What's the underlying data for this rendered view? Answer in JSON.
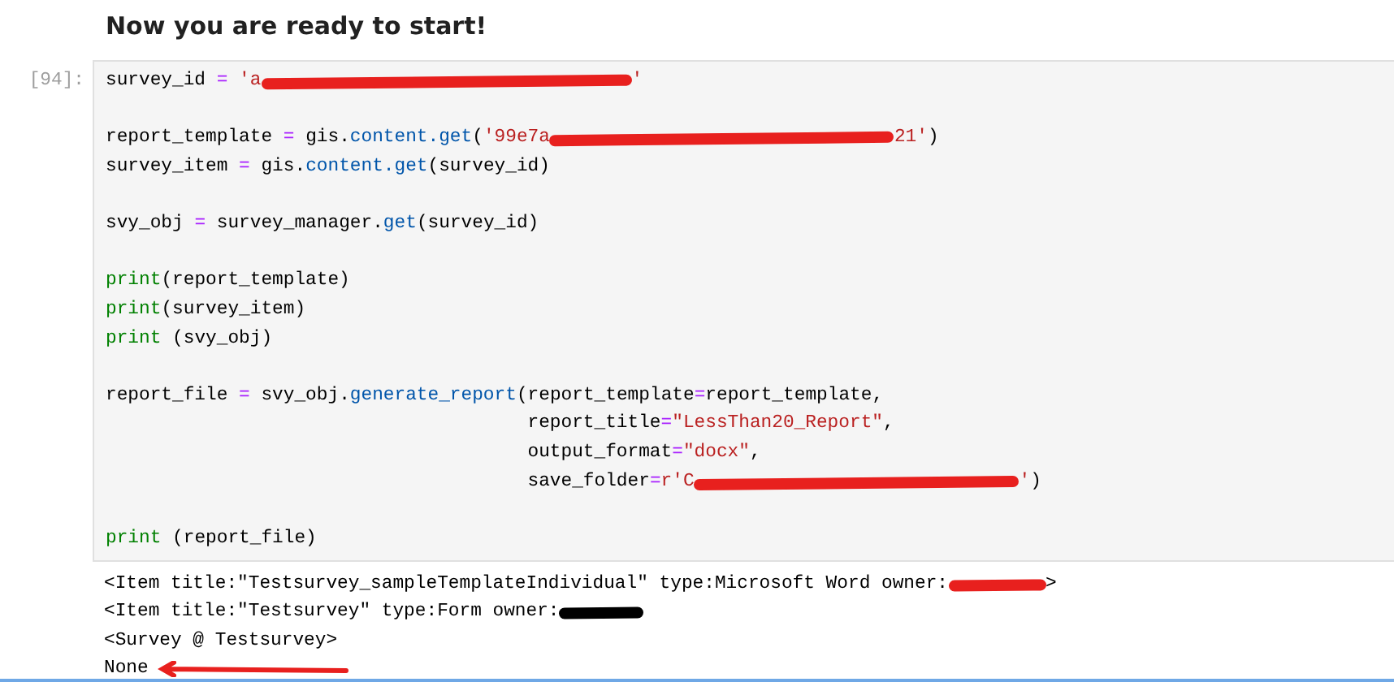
{
  "heading": "Now you are ready to start!",
  "cell": {
    "prompt": "[94]:",
    "lines": [
      {
        "kind": "code",
        "segments": [
          {
            "kind": "code",
            "tokens": [
              {
                "kind": "name",
                "text": "survey_id"
              },
              {
                "kind": "op",
                "text": " = "
              },
              {
                "kind": "str",
                "text": "'a"
              }
            ]
          },
          {
            "kind": "redaction",
            "color": "#e8201e"
          },
          {
            "kind": "code",
            "tokens": [
              {
                "kind": "str",
                "text": "'"
              }
            ]
          }
        ]
      },
      {
        "kind": "blank"
      },
      {
        "kind": "code",
        "segments": [
          {
            "kind": "code",
            "tokens": [
              {
                "kind": "name",
                "text": "report_template"
              },
              {
                "kind": "op",
                "text": " = "
              },
              {
                "kind": "name",
                "text": "gis."
              },
              {
                "kind": "prop",
                "text": "content.get"
              },
              {
                "kind": "name",
                "text": "("
              },
              {
                "kind": "str",
                "text": "'99e7a"
              }
            ]
          },
          {
            "kind": "redaction",
            "color": "#e8201e"
          },
          {
            "kind": "code",
            "tokens": [
              {
                "kind": "str",
                "text": "21'"
              },
              {
                "kind": "name",
                "text": ")"
              }
            ]
          }
        ]
      },
      {
        "kind": "code",
        "segments": [
          {
            "kind": "code",
            "tokens": [
              {
                "kind": "name",
                "text": "survey_item"
              },
              {
                "kind": "op",
                "text": " = "
              },
              {
                "kind": "name",
                "text": "gis."
              },
              {
                "kind": "prop",
                "text": "content.get"
              },
              {
                "kind": "name",
                "text": "(survey_id)"
              }
            ]
          }
        ]
      },
      {
        "kind": "blank"
      },
      {
        "kind": "code",
        "segments": [
          {
            "kind": "code",
            "tokens": [
              {
                "kind": "name",
                "text": "svy_obj"
              },
              {
                "kind": "op",
                "text": " = "
              },
              {
                "kind": "name",
                "text": "survey_manager."
              },
              {
                "kind": "prop",
                "text": "get"
              },
              {
                "kind": "name",
                "text": "(survey_id)"
              }
            ]
          }
        ]
      },
      {
        "kind": "blank"
      },
      {
        "kind": "code",
        "segments": [
          {
            "kind": "code",
            "tokens": [
              {
                "kind": "builtin",
                "text": "print"
              },
              {
                "kind": "name",
                "text": "(report_template)"
              }
            ]
          }
        ]
      },
      {
        "kind": "code",
        "segments": [
          {
            "kind": "code",
            "tokens": [
              {
                "kind": "builtin",
                "text": "print"
              },
              {
                "kind": "name",
                "text": "(survey_item)"
              }
            ]
          }
        ]
      },
      {
        "kind": "code",
        "segments": [
          {
            "kind": "code",
            "tokens": [
              {
                "kind": "builtin",
                "text": "print"
              },
              {
                "kind": "name",
                "text": " (svy_obj)"
              }
            ]
          }
        ]
      },
      {
        "kind": "blank"
      },
      {
        "kind": "code",
        "segments": [
          {
            "kind": "code",
            "tokens": [
              {
                "kind": "name",
                "text": "report_file"
              },
              {
                "kind": "op",
                "text": " = "
              },
              {
                "kind": "name",
                "text": "svy_obj."
              },
              {
                "kind": "prop",
                "text": "generate_report"
              },
              {
                "kind": "name",
                "text": "(report_template"
              },
              {
                "kind": "op",
                "text": "="
              },
              {
                "kind": "name",
                "text": "report_template,"
              }
            ]
          }
        ]
      },
      {
        "kind": "continuation",
        "segments": [
          {
            "kind": "code",
            "tokens": [
              {
                "kind": "name",
                "text": "report_title"
              },
              {
                "kind": "op",
                "text": "="
              },
              {
                "kind": "str",
                "text": "\"LessThan20_Report\""
              },
              {
                "kind": "name",
                "text": ","
              }
            ]
          }
        ]
      },
      {
        "kind": "continuation",
        "segments": [
          {
            "kind": "code",
            "tokens": [
              {
                "kind": "name",
                "text": "output_format"
              },
              {
                "kind": "op",
                "text": "="
              },
              {
                "kind": "str",
                "text": "\"docx\""
              },
              {
                "kind": "name",
                "text": ","
              }
            ]
          }
        ]
      },
      {
        "kind": "continuation",
        "segments": [
          {
            "kind": "code",
            "tokens": [
              {
                "kind": "name",
                "text": "save_folder"
              },
              {
                "kind": "op",
                "text": "="
              },
              {
                "kind": "str",
                "text": "r'C"
              }
            ]
          },
          {
            "kind": "redaction",
            "color": "#e8201e"
          },
          {
            "kind": "code",
            "tokens": [
              {
                "kind": "str",
                "text": "'"
              },
              {
                "kind": "name",
                "text": ")"
              }
            ]
          }
        ]
      },
      {
        "kind": "blank"
      },
      {
        "kind": "code",
        "segments": [
          {
            "kind": "code",
            "tokens": [
              {
                "kind": "builtin",
                "text": "print"
              },
              {
                "kind": "name",
                "text": " (report_file)"
              }
            ]
          }
        ]
      }
    ],
    "output": [
      {
        "segments": [
          {
            "kind": "text",
            "text": "<Item title:\"Testsurvey_sampleTemplateIndividual\" type:Microsoft Word owner:"
          },
          {
            "kind": "redaction",
            "color": "#e8201e"
          },
          {
            "kind": "text",
            "text": ">"
          }
        ]
      },
      {
        "segments": [
          {
            "kind": "text",
            "text": "<Item title:\"Testsurvey\" type:Form owner:"
          },
          {
            "kind": "redaction",
            "color": "#000000"
          }
        ]
      },
      {
        "segments": [
          {
            "kind": "text",
            "text": "<Survey @ Testsurvey>"
          }
        ]
      },
      {
        "segments": [
          {
            "kind": "text",
            "text": "None"
          },
          {
            "kind": "arrow",
            "color": "#e8201e"
          }
        ]
      }
    ]
  }
}
